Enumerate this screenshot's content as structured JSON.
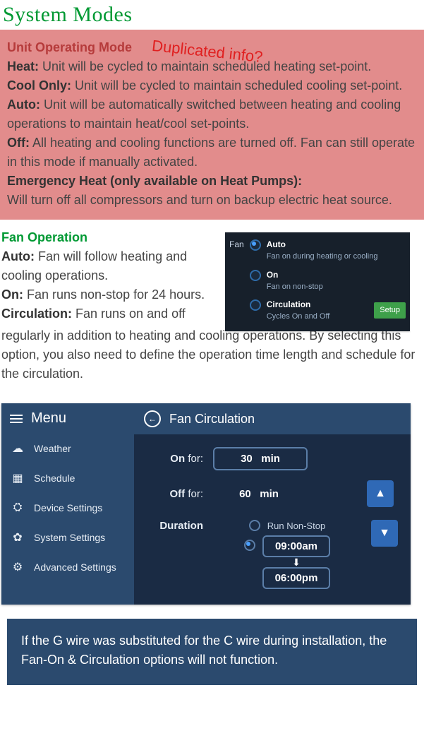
{
  "page_title": "System Modes",
  "annotation": "Duplicated info?",
  "unit_operating": {
    "heading": "Unit Operating Mode",
    "heat_label": "Heat:",
    "heat_text": " Unit will be cycled to maintain scheduled heating set-point.",
    "cool_label": "Cool Only:",
    "cool_text": " Unit will be cycled to maintain scheduled cooling set-point.",
    "auto_label": "Auto:",
    "auto_text": " Unit will be automatically switched between heating and cooling operations to maintain heat/cool set-points.",
    "off_label": "Off:",
    "off_text": " All heating and cooling functions are turned off. Fan can still operate in this mode if manually activated.",
    "eheat_label": "Emergency Heat (only available on Heat Pumps):",
    "eheat_text": "Will turn off all compressors and turn on backup electric heat source."
  },
  "fan_operation": {
    "heading": "Fan Operation",
    "auto_label": "Auto:",
    "auto_text": " Fan will follow heating and cooling operations.",
    "on_label": "On:",
    "on_text": " Fan runs non-stop for 24 hours.",
    "circ_label": "Circulation:",
    "circ_text_1": " Fan runs on and off",
    "circ_text_2": "regularly in addition to heating and cooling operations. By selecting this option, you also need to define the operation time length and schedule for the circulation."
  },
  "fan_panel": {
    "title": "Fan",
    "opts": [
      {
        "title": "Auto",
        "sub": "Fan on during heating or cooling",
        "selected": true
      },
      {
        "title": "On",
        "sub": "Fan on non-stop",
        "selected": false
      },
      {
        "title": "Circulation",
        "sub": "Cycles On and Off",
        "selected": false
      }
    ],
    "setup": "Setup"
  },
  "menu": {
    "header": "Menu",
    "items": [
      "Weather",
      "Schedule",
      "Device Settings",
      "System Settings",
      "Advanced Settings"
    ]
  },
  "circ_screen": {
    "title": "Fan Circulation",
    "on_label": "On",
    "for_label": "for:",
    "off_label": "Off",
    "on_value": "30",
    "on_unit": "min",
    "off_value": "60",
    "off_unit": "min",
    "duration_label": "Duration",
    "run_nonstop": "Run Non-Stop",
    "start_time": "09:00am",
    "end_time": "06:00pm"
  },
  "note": "If the G wire was substituted for the C wire during installation, the Fan-On & Circulation options will not function."
}
